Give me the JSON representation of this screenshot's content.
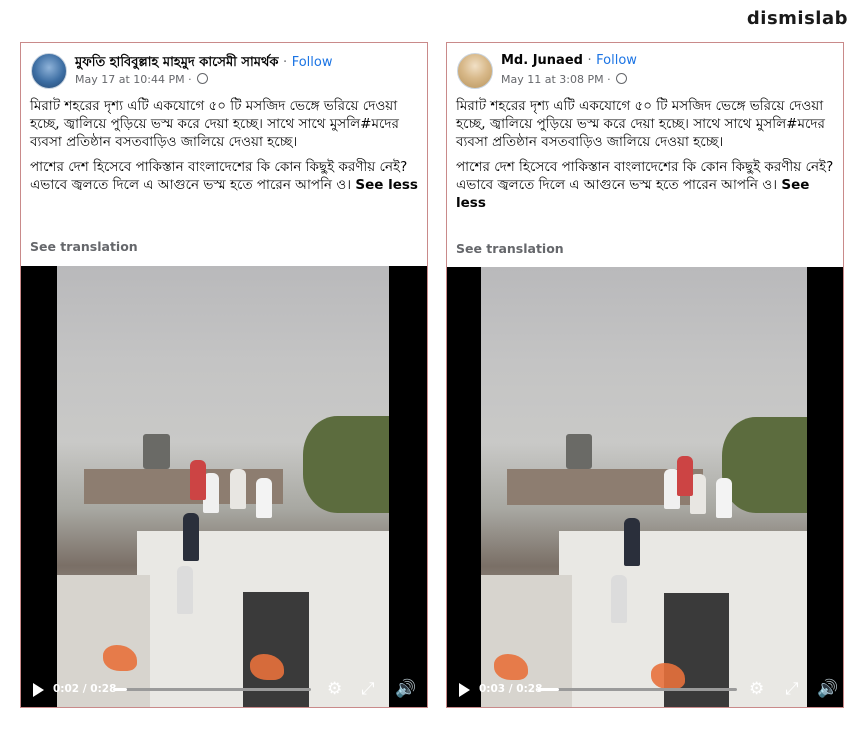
{
  "brand": "dismislab",
  "posts": [
    {
      "author": "মুফতি হাবিবুল্লাহ মাহমুদ কাসেমী সামর্থক",
      "follow": "Follow",
      "date": "May 17 at 10:44 PM",
      "para1": "মিরাট শহরের দৃশ্য এটি একযোগে ৫০ টি মসজিদ ভেঙ্গে ভরিয়ে দেওয়া হচ্ছে, জ্বালিয়ে পুড়িয়ে ভস্ম করে দেয়া হচ্ছে। সাথে সাথে মুসলি#মদের ব্যবসা প্রতিষ্ঠান বসতবাড়িও জালিয়ে দেওয়া হচ্ছে।",
      "para2": "পাশের দেশ হিসেবে পাকিস্তান বাংলাদেশের কি কোন কিছুই করণীয় নেই? এভাবে জ্বলতে দিলে এ আগুনে ভস্ম হতে পারেন আপনি ও।",
      "see_less": "See less",
      "see_translation": "See translation",
      "video_time": "0:02 / 0:28",
      "progress": 0.07
    },
    {
      "author": "Md. Junaed",
      "follow": "Follow",
      "date": "May 11 at 3:08 PM",
      "para1": "মিরাট শহরের দৃশ্য এটি একযোগে ৫০ টি মসজিদ ভেঙ্গে ভরিয়ে দেওয়া হচ্ছে, জ্বালিয়ে পুড়িয়ে ভস্ম করে দেয়া হচ্ছে। সাথে সাথে মুসলি#মদের ব্যবসা প্রতিষ্ঠান বসতবাড়িও জালিয়ে দেওয়া হচ্ছে।",
      "para2": "পাশের দেশ হিসেবে পাকিস্তান বাংলাদেশের কি কোন কিছুই করণীয় নেই? এভাবে জ্বলতে দিলে এ আগুনে ভস্ম হতে পারেন আপনি ও।",
      "see_less": "See less",
      "see_translation": "See translation",
      "video_time": "0:03 / 0:28",
      "progress": 0.11
    }
  ]
}
